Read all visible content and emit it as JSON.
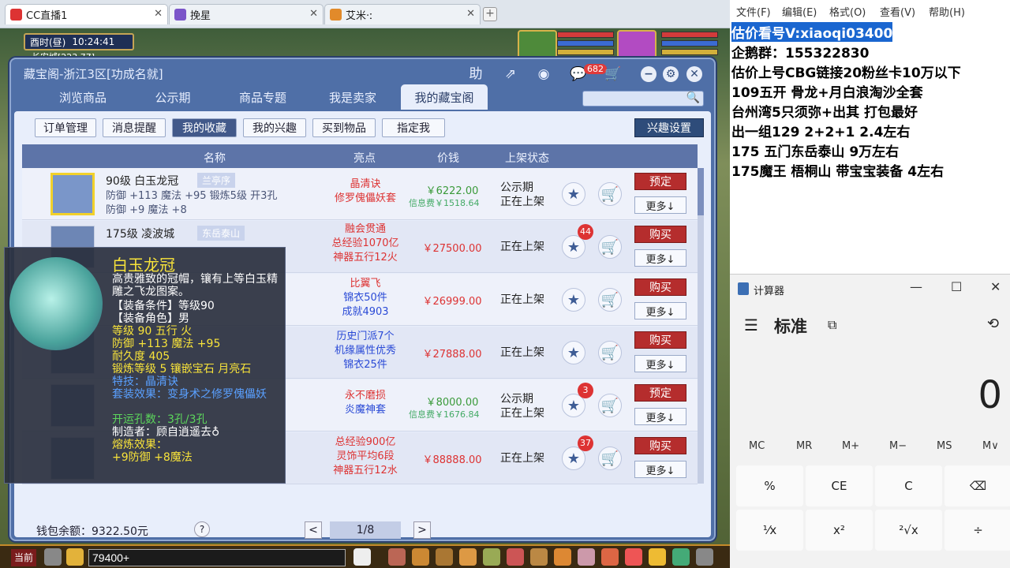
{
  "browser": {
    "tabs": [
      {
        "label": "CC直播1",
        "close": "✕"
      },
      {
        "label": "挽星",
        "close": "✕"
      },
      {
        "label": "艾米·ː",
        "close": "✕"
      }
    ],
    "new_tab": "+"
  },
  "hud": {
    "time_period": "酉时(昼)",
    "clock": "10:24:41",
    "location": "长安城[223,77]"
  },
  "panel": {
    "title": "藏宝阁-浙江3区[功成名就]",
    "help_btn": "助",
    "message_count": "682",
    "nav_tabs": [
      "浏览商品",
      "公示期",
      "商品专题",
      "我是卖家",
      "我的藏宝阁"
    ],
    "active_nav": "我的藏宝阁",
    "sub_tabs": [
      "订单管理",
      "消息提醒",
      "我的收藏",
      "我的兴趣",
      "买到物品",
      "指定我"
    ],
    "active_sub": "我的收藏",
    "interest_btn": "兴趣设置",
    "columns": {
      "name": "名称",
      "highlight": "亮点",
      "price": "价钱",
      "status": "上架状态"
    }
  },
  "rows": [
    {
      "name": "90级 白玉龙冠",
      "server": "兰亭序",
      "stat1": "防御 +113 魔法 +95 锻炼5级 开3孔",
      "stat2": "防御 +9 魔法 +8",
      "hl1": "晶清诀",
      "hl2": "修罗傀儡妖套",
      "price": "￥6222.00",
      "fee": "信息费￥1518.64",
      "status1": "公示期",
      "status2": "正在上架",
      "count": "",
      "action": "预定",
      "more": "更多↓"
    },
    {
      "name": "175级 凌波城",
      "server": "东岳泰山",
      "stat1": "",
      "stat2": "",
      "hl1": "融会贯通",
      "hl2": "总经验1070亿",
      "hl3": "神器五行12火",
      "price": "￥27500.00",
      "fee": "",
      "status1": "正在上架",
      "status2": "",
      "count": "44",
      "action": "购买",
      "more": "更多↓"
    },
    {
      "name": "",
      "server": "",
      "stat1": "",
      "stat2": "",
      "hl1": "比翼飞",
      "hl2": "锦衣50件",
      "hl3": "成就4903",
      "price": "￥26999.00",
      "fee": "",
      "status1": "正在上架",
      "status2": "",
      "count": "",
      "action": "购买",
      "more": "更多↓"
    },
    {
      "name": "",
      "server": "",
      "stat1": "",
      "stat2": "",
      "hl1": "历史门派7个",
      "hl2": "机缘属性优秀",
      "hl3": "锦衣25件",
      "price": "￥27888.00",
      "fee": "",
      "status1": "正在上架",
      "status2": "",
      "count": "",
      "action": "购买",
      "more": "更多↓"
    },
    {
      "name": "",
      "server": "",
      "stat1": "",
      "stat2": "",
      "hl1": "永不磨损",
      "hl2": "炎魔神套",
      "price": "￥8000.00",
      "fee": "信息费￥1676.84",
      "status1": "公示期",
      "status2": "正在上架",
      "count": "3",
      "action": "预定",
      "more": "更多↓"
    },
    {
      "name": "",
      "server": "",
      "stat1": "",
      "stat2": "",
      "hl1": "总经验900亿",
      "hl2": "灵饰平均6段",
      "hl3": "神器五行12水",
      "price": "￥88888.00",
      "fee": "",
      "status1": "正在上架",
      "status2": "",
      "count": "37",
      "action": "购买",
      "more": "更多↓"
    }
  ],
  "footer": {
    "wallet": "钱包余额：9322.50元",
    "help": "?",
    "prev": "<",
    "page": "1/8",
    "next": ">"
  },
  "tooltip": {
    "title": "白玉龙冠",
    "desc": "高贵雅致的冠帽，镶有上等白玉精雕之飞龙图案。",
    "req_level": "【装备条件】等级90",
    "req_role": "【装备角色】男",
    "level": "等级 90  五行 火",
    "stats": "防御 +113 魔法 +95",
    "durability": "耐久度 405",
    "forge": "锻炼等级 5  镶嵌宝石 月亮石",
    "skill": "特技：晶清诀",
    "set": "套装效果：变身术之修罗傀儡妖",
    "holes": "开运孔数：3孔/3孔",
    "maker": "制造者：顾自逍遥去♁",
    "melt": "熔炼效果：",
    "melt_stats": "+9防御 +8魔法"
  },
  "bottom": {
    "btn": "当前",
    "input_value": "79400+"
  },
  "notepad": {
    "menu": [
      "文件(F)",
      "编辑(E)",
      "格式(O)",
      "查看(V)",
      "帮助(H)"
    ],
    "lines": [
      "估价看号V:xiaoqi03400",
      "企鹅群：155322830",
      "估价上号CBG链接20粉丝卡10万以下",
      "109五开 骨龙+月白浪淘沙全套",
      "台州湾5只须弥+出其 打包最好",
      "出一组129 2+2+1  2.4左右",
      "175 五门东岳泰山 9万左右",
      "175魔王 梧桐山 带宝宝装备 4左右"
    ]
  },
  "calculator": {
    "title": "计算器",
    "mode": "标准",
    "display": "0",
    "memory": [
      "MC",
      "MR",
      "M+",
      "M−",
      "MS",
      "M∨"
    ],
    "keys_row1": [
      "%",
      "CE",
      "C",
      "⌫"
    ],
    "keys_row2": [
      "¹⁄x",
      "x²",
      "²√x",
      "÷"
    ]
  }
}
